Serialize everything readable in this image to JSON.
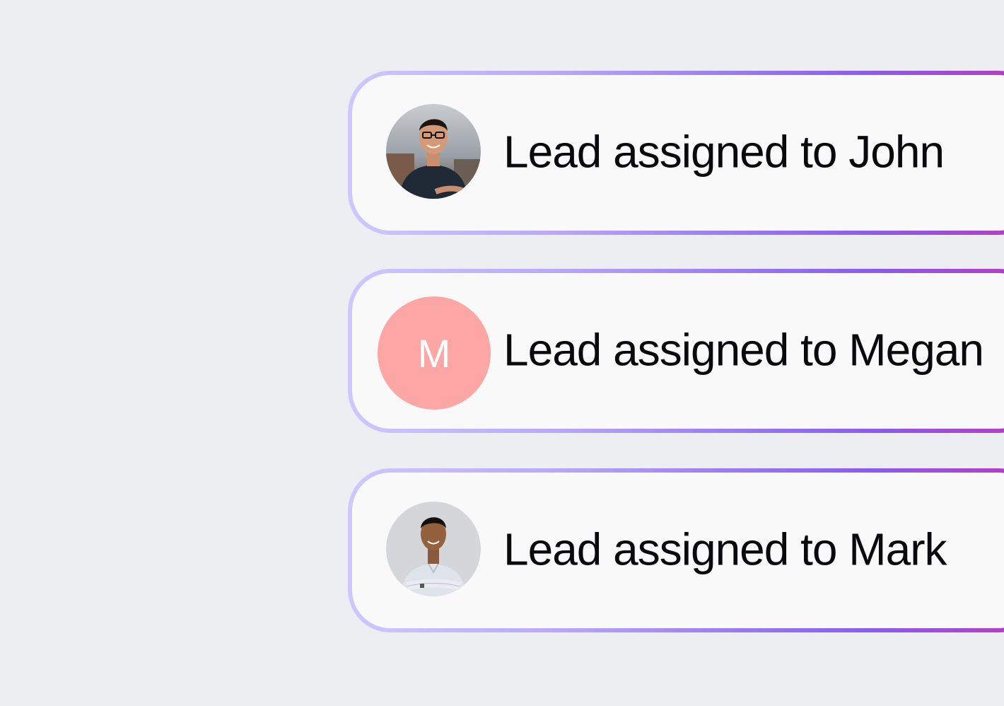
{
  "notifications": [
    {
      "text": "Lead assigned to John",
      "avatar_type": "photo",
      "avatar_icon": "person-photo-avatar"
    },
    {
      "text": "Lead assigned to Megan",
      "avatar_type": "initial",
      "avatar_initial": "M",
      "avatar_color": "#fda6a6"
    },
    {
      "text": "Lead assigned to Mark",
      "avatar_type": "photo",
      "avatar_icon": "person-photo-avatar"
    }
  ],
  "colors": {
    "background": "#edeef2",
    "card_fill": "#f9f9fa",
    "border_gradient_start": "#cfc8ff",
    "border_gradient_end": "#c034b8"
  }
}
